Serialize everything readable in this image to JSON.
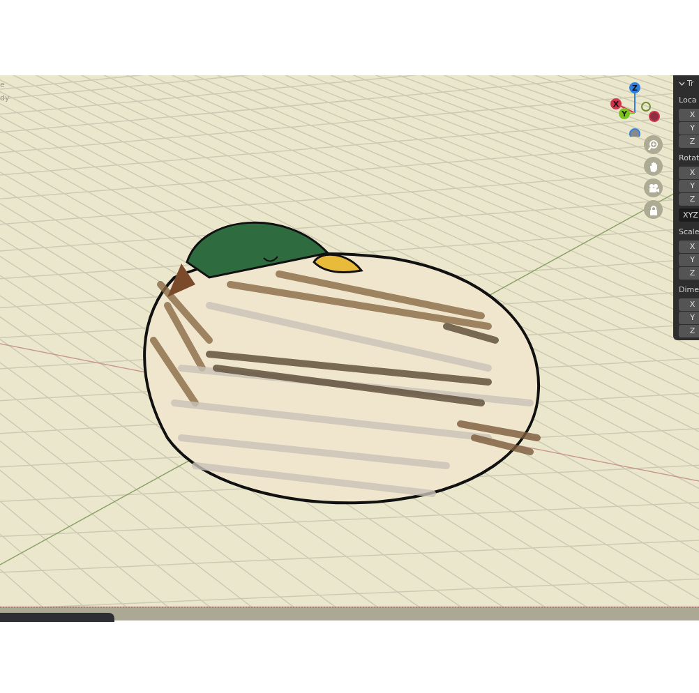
{
  "viewport": {
    "overlay_text": [
      "e",
      "dy"
    ]
  },
  "gizmo": {
    "axes": [
      {
        "label": "Z",
        "kind": "z"
      },
      {
        "label": "X",
        "kind": "x"
      },
      {
        "label": "Y",
        "kind": "y"
      }
    ]
  },
  "nav_buttons": [
    {
      "kind": "zoom"
    },
    {
      "kind": "pan"
    },
    {
      "kind": "camera"
    },
    {
      "kind": "lock"
    }
  ],
  "sidebar": {
    "header": "Tr",
    "groups": [
      {
        "label": "Loca",
        "fields": [
          "X",
          "Y",
          "Z"
        ]
      },
      {
        "label": "Rotat",
        "fields": [
          "X",
          "Y",
          "Z"
        ],
        "mode": "XYZ"
      },
      {
        "label": "Scale",
        "fields": [
          "X",
          "Y",
          "Z"
        ]
      },
      {
        "label": "Dime",
        "fields": [
          "X",
          "Y",
          "Z"
        ]
      }
    ]
  }
}
